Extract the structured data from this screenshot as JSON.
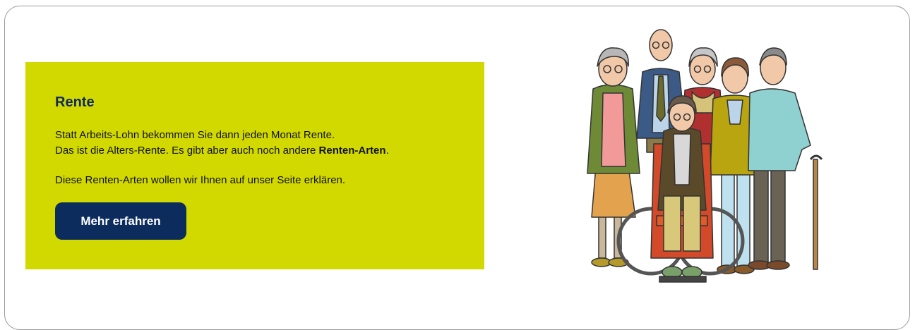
{
  "teaser": {
    "title": "Rente",
    "line1": "Statt Arbeits-Lohn bekommen Sie dann jeden Monat Rente.",
    "line2_prefix": "Das ist die Alters-Rente. Es gibt aber auch noch andere ",
    "line2_bold": "Renten-Arten",
    "line2_suffix": ".",
    "paragraph2": "Diese Renten-Arten wollen wir Ihnen auf unser Seite erklären.",
    "button_label": "Mehr erfahren"
  },
  "illustration": {
    "icon": "group-of-seniors-illustration"
  },
  "colors": {
    "teaser_bg": "#d2d900",
    "title": "#0e2a5c",
    "button_bg": "#0c2c5e"
  }
}
